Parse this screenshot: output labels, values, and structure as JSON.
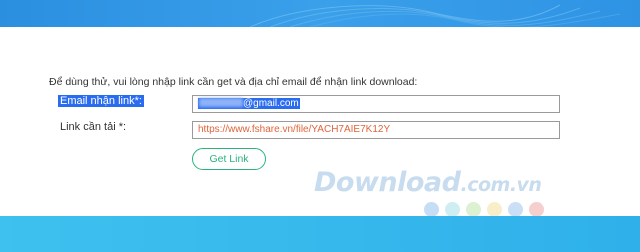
{
  "instruction": "Để dùng thử, vui lòng nhập link cần get và địa chỉ email để nhận link download:",
  "form": {
    "email_label": "Email nhận link*:",
    "email_suffix": "@gmail.com",
    "link_label": "Link cần tải *:",
    "link_value": "https://www.fshare.vn/file/YACH7AIE7K12Y",
    "get_link_button": "Get Link"
  },
  "watermark": {
    "brand": "Download",
    "domain": ".com.vn",
    "dot_colors": [
      "#bfdaf4",
      "#c9ecef",
      "#d7f0cc",
      "#f7ecc4",
      "#c4dcf5",
      "#f6c9c9"
    ]
  },
  "colors": {
    "accent": "#2bb37a",
    "selection": "#2a6cf0",
    "link_text": "#e0643a",
    "banner": "#2f93e4"
  }
}
